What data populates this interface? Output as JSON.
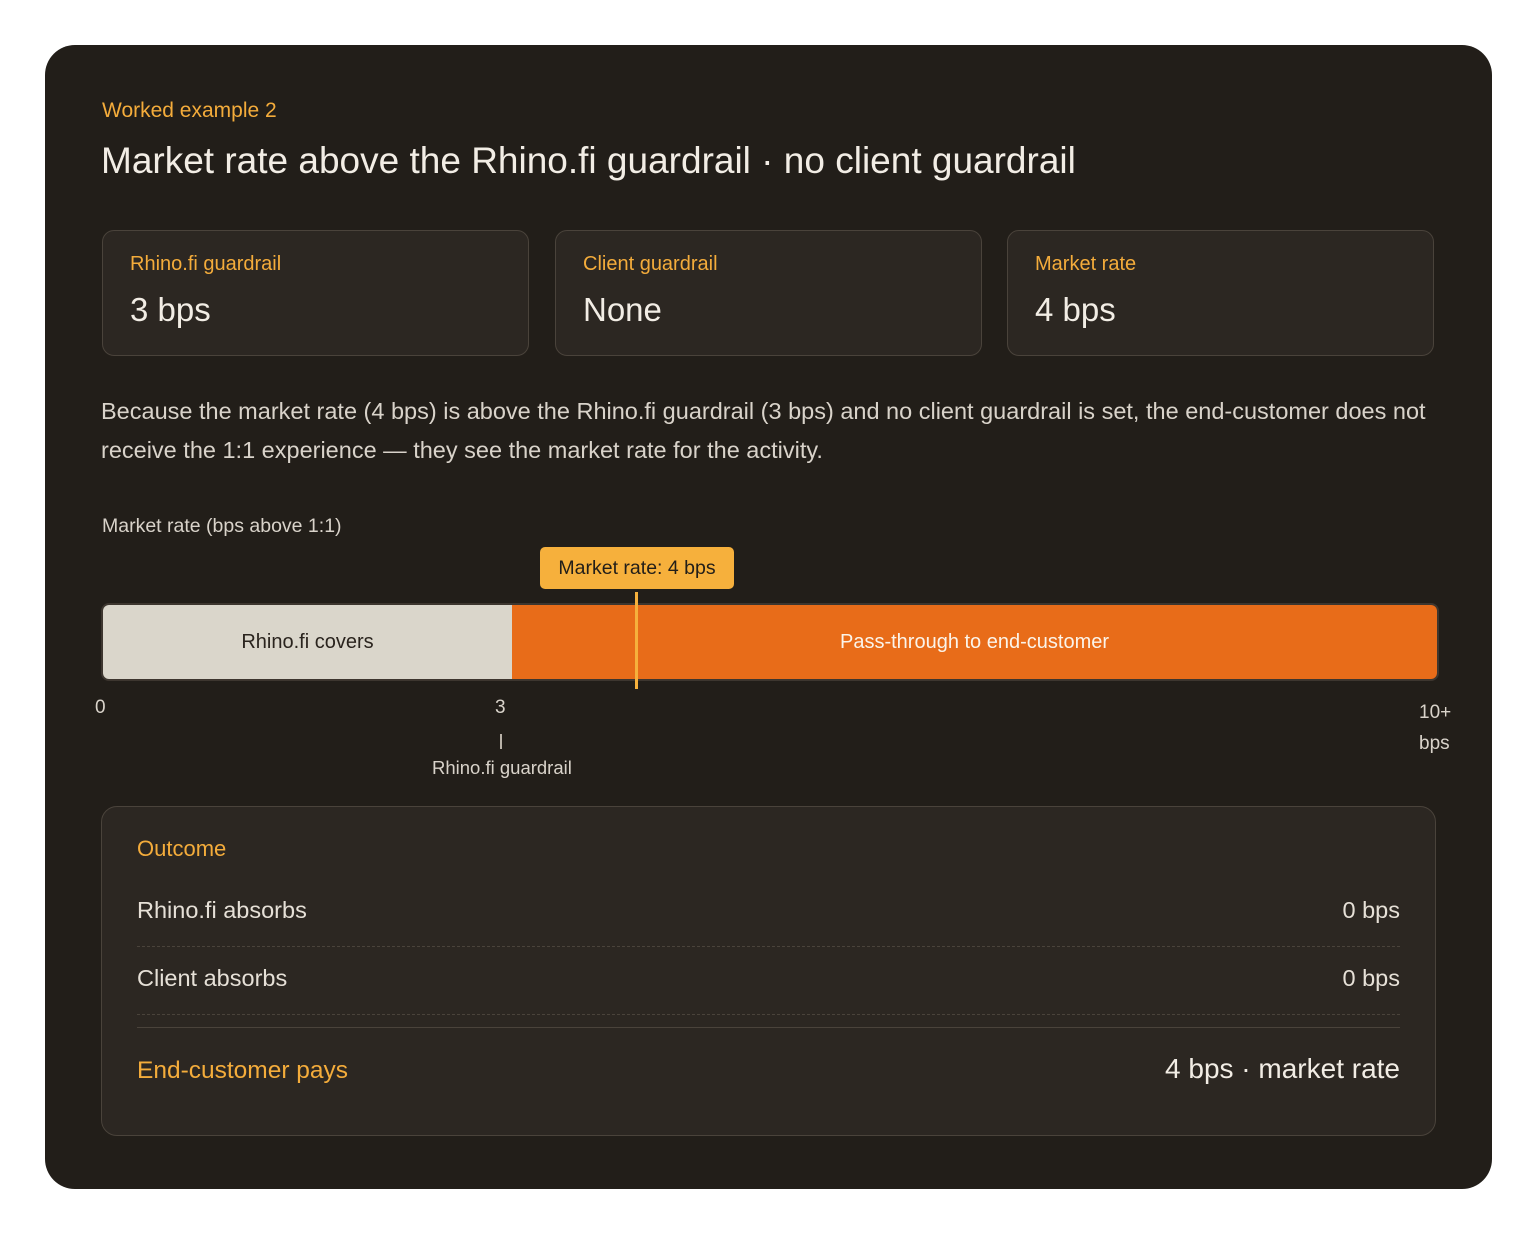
{
  "header": {
    "eyebrow": "Worked example 2",
    "title": "Market rate above the Rhino.fi guardrail · no client guardrail"
  },
  "stats": [
    {
      "label": "Rhino.fi guardrail",
      "value": "3 bps"
    },
    {
      "label": "Client guardrail",
      "value": "None"
    },
    {
      "label": "Market rate",
      "value": "4 bps"
    }
  ],
  "description": "Because the market rate (4 bps) is above the Rhino.fi guardrail (3 bps) and no client guardrail is set, the end-customer does not receive the 1:1 experience — they see the market rate for the activity.",
  "bar": {
    "caption": "Market rate (bps above 1:1)",
    "marker_label": "Market rate: 4 bps",
    "marker_value": 4,
    "scale_max": 10,
    "segments": [
      {
        "label": "Rhino.fi covers",
        "from": 0,
        "to": 3,
        "color": "#dad6cb"
      },
      {
        "label": "Pass-through to end-customer",
        "from": 3,
        "to": 10,
        "color": "#e86c19"
      }
    ],
    "ticks": {
      "zero": "0",
      "guardrail": "3",
      "max": "10+",
      "unit": "bps"
    },
    "guardrail_label": "Rhino.fi guardrail"
  },
  "outcome": {
    "title": "Outcome",
    "rows": [
      {
        "label": "Rhino.fi absorbs",
        "value": "0 bps"
      },
      {
        "label": "Client absorbs",
        "value": "0 bps"
      }
    ],
    "final": {
      "label": "End-customer pays",
      "value": "4 bps · market rate"
    }
  },
  "colors": {
    "accent": "#f4ac3b",
    "pass_through": "#e86c19",
    "covered": "#dad6cb",
    "card_bg": "#221e19"
  }
}
